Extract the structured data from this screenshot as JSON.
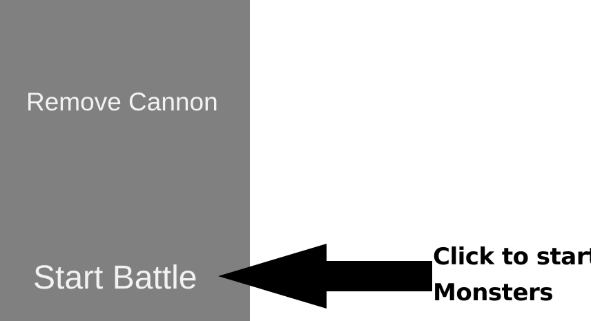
{
  "panel": {
    "background_color": "#808080",
    "remove_cannon_label": "Remove Cannon",
    "start_battle_label": "Start Battle"
  },
  "annotation": {
    "arrow_color": "#000000",
    "line1": "Click to start",
    "line2": "Monsters"
  }
}
